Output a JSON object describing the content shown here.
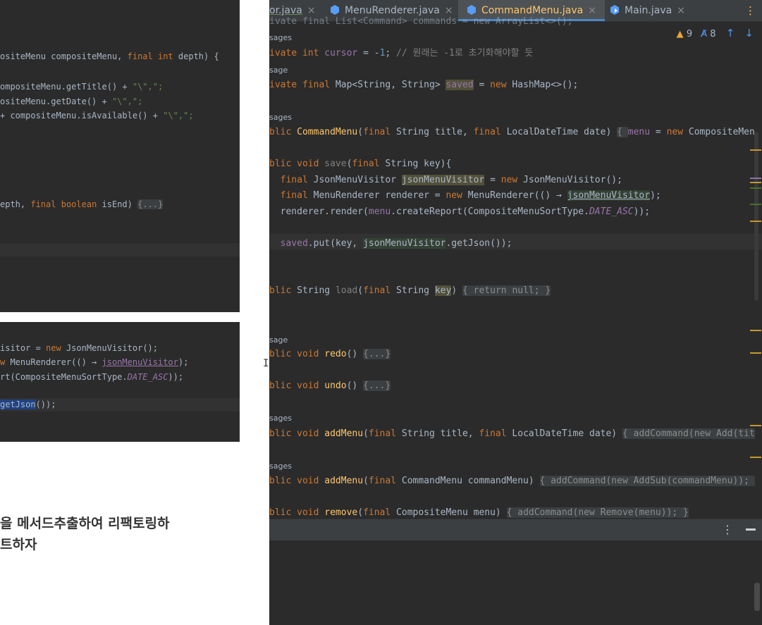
{
  "left_shots": {
    "shot1_lines": [
      {
        "parts": [
          [
            "osite",
            "t"
          ],
          [
            "Menu",
            "t"
          ],
          [
            " compositeMenu, ",
            "t"
          ],
          [
            "final",
            "kw"
          ],
          [
            " ",
            "t"
          ],
          [
            "int",
            "kw"
          ],
          [
            " depth) {",
            "t"
          ]
        ]
      },
      {
        "parts": [
          [
            "ompositeMenu.getTitle() + ",
            "t"
          ],
          [
            "\"\\\",\";",
            "str"
          ]
        ]
      },
      {
        "parts": [
          [
            "ositeMenu.getDate() + ",
            "t"
          ],
          [
            "\"\\\",\";",
            "str"
          ]
        ]
      },
      {
        "parts": [
          [
            "+ compositeMenu.isAvailable() + ",
            "t"
          ],
          [
            "\"\\\",\";",
            "str"
          ]
        ]
      },
      {
        "parts": [
          [
            "epth, ",
            "t"
          ],
          [
            "final",
            "kw"
          ],
          [
            " ",
            "t"
          ],
          [
            "boolean",
            "kw"
          ],
          [
            " isEnd) ",
            "t"
          ],
          [
            "{...}",
            "fold"
          ]
        ]
      }
    ],
    "shot2_lines": [
      {
        "parts": [
          [
            "isitor = ",
            "t"
          ],
          [
            "new",
            "kw"
          ],
          [
            " JsonMenuVisitor();",
            "t"
          ]
        ]
      },
      {
        "parts": [
          [
            "w",
            "kw"
          ],
          [
            " MenuRenderer(() → ",
            "t"
          ],
          [
            "jsonMenuVisitor",
            "field ul"
          ],
          [
            ");",
            "t"
          ]
        ]
      },
      {
        "parts": [
          [
            "rt(CompositeMenuSortType.",
            "t"
          ],
          [
            "DATE_ASC",
            "field it"
          ],
          [
            "));",
            "t"
          ]
        ]
      },
      {
        "parts": [
          [
            "getJson",
            "sel"
          ],
          [
            "());",
            "t"
          ]
        ]
      }
    ]
  },
  "caption": {
    "line1": "을 메서드추출하여 리팩토링하",
    "line2": "트하자"
  },
  "tabs": [
    {
      "label": "or.java",
      "icon": "none",
      "active": false
    },
    {
      "label": "MenuRenderer.java",
      "icon": "class-icon",
      "active": false
    },
    {
      "label": "CommandMenu.java",
      "icon": "class-icon",
      "active": true
    },
    {
      "label": "Main.java",
      "icon": "main-class-icon",
      "active": false
    }
  ],
  "tab_close_glyph": "×",
  "tab_menu_glyph": "⋮",
  "inspections": {
    "warnings": "9",
    "typos": "8",
    "warn_glyph": "▲",
    "typo_glyph": "A̸",
    "up": "↑",
    "down": "↓"
  },
  "code_lines": [
    {
      "kind": "code",
      "parts": [
        [
          "ivate final List<Command> commands = new ArrayList<>();",
          "t"
        ]
      ]
    },
    {
      "kind": "hint",
      "text": "sages"
    },
    {
      "kind": "code",
      "parts": [
        [
          "ivate",
          "kw"
        ],
        [
          " ",
          "t"
        ],
        [
          "int",
          "kw"
        ],
        [
          " ",
          "t"
        ],
        [
          "cursor",
          "field"
        ],
        [
          " = -",
          "t"
        ],
        [
          "1",
          "num"
        ],
        [
          "; ",
          "t"
        ],
        [
          "// 원래는 -1로 초기화해야할 듯",
          "cmt"
        ]
      ]
    },
    {
      "kind": "hint",
      "text": "sage"
    },
    {
      "kind": "code",
      "parts": [
        [
          "ivate",
          "kw"
        ],
        [
          " ",
          "t"
        ],
        [
          "final",
          "kw"
        ],
        [
          " Map<String, String> ",
          "t"
        ],
        [
          "saved",
          "field hl2"
        ],
        [
          " = ",
          "t"
        ],
        [
          "new",
          "kw"
        ],
        [
          " HashMap<>();",
          "t"
        ]
      ]
    },
    {
      "kind": "hint",
      "text": "sages"
    },
    {
      "kind": "code",
      "parts": [
        [
          "blic",
          "kw"
        ],
        [
          " ",
          "t"
        ],
        [
          "CommandMenu",
          "fn"
        ],
        [
          "(",
          "t"
        ],
        [
          "final",
          "kw"
        ],
        [
          " String title, ",
          "t"
        ],
        [
          "final",
          "kw"
        ],
        [
          " LocalDateTime date) ",
          "t"
        ],
        [
          "{ ",
          "fold"
        ],
        [
          "menu",
          "field"
        ],
        [
          " = ",
          "t"
        ],
        [
          "new",
          "kw"
        ],
        [
          " CompositeMen",
          "t"
        ]
      ]
    },
    {
      "kind": "code",
      "parts": [
        [
          "blic",
          "kw"
        ],
        [
          " ",
          "t"
        ],
        [
          "void",
          "kw"
        ],
        [
          " ",
          "t"
        ],
        [
          "save",
          "cmt"
        ],
        [
          "(",
          "t"
        ],
        [
          "final",
          "kw"
        ],
        [
          " String key){",
          "t"
        ]
      ]
    },
    {
      "kind": "code",
      "parts": [
        [
          "  ",
          "t"
        ],
        [
          "final",
          "kw"
        ],
        [
          " JsonMenuVisitor ",
          "t"
        ],
        [
          "jsonMenuVisitor",
          "hl2"
        ],
        [
          " = ",
          "t"
        ],
        [
          "new",
          "kw"
        ],
        [
          " JsonMenuVisitor();",
          "t"
        ]
      ]
    },
    {
      "kind": "code",
      "parts": [
        [
          "  ",
          "t"
        ],
        [
          "final",
          "kw"
        ],
        [
          " MenuRenderer renderer = ",
          "t"
        ],
        [
          "new",
          "kw"
        ],
        [
          " MenuRenderer(() → ",
          "t"
        ],
        [
          "jsonMenuVisitor",
          "ul hl"
        ],
        [
          ");",
          "t"
        ]
      ]
    },
    {
      "kind": "code",
      "parts": [
        [
          "  renderer.render(",
          "t"
        ],
        [
          "menu",
          "field"
        ],
        [
          ".createReport(CompositeMenuSortType.",
          "t"
        ],
        [
          "DATE_ASC",
          "field it"
        ],
        [
          "));",
          "t"
        ]
      ]
    },
    {
      "kind": "code",
      "parts": [
        [
          "  ",
          "t"
        ],
        [
          "saved",
          "field"
        ],
        [
          ".put(key, ",
          "t"
        ],
        [
          "jsonMenuVisitor",
          "hl"
        ],
        [
          ".getJson());",
          "t"
        ]
      ]
    },
    {
      "kind": "code",
      "parts": [
        [
          "blic",
          "kw"
        ],
        [
          " String ",
          "t"
        ],
        [
          "load",
          "cmt"
        ],
        [
          "(",
          "t"
        ],
        [
          "final",
          "kw"
        ],
        [
          " String ",
          "t"
        ],
        [
          "key",
          "hl2"
        ],
        [
          ") ",
          "t"
        ],
        [
          "{ ",
          "fold"
        ],
        [
          "return",
          "kw fold"
        ],
        [
          " ",
          "fold"
        ],
        [
          "null",
          "kw fold"
        ],
        [
          "; }",
          "fold"
        ]
      ]
    },
    {
      "kind": "hint",
      "text": "sage"
    },
    {
      "kind": "code",
      "parts": [
        [
          "blic",
          "kw"
        ],
        [
          " ",
          "t"
        ],
        [
          "void",
          "kw"
        ],
        [
          " ",
          "t"
        ],
        [
          "redo",
          "fn"
        ],
        [
          "() ",
          "t"
        ],
        [
          "{...}",
          "fold"
        ]
      ]
    },
    {
      "kind": "code",
      "parts": [
        [
          "blic",
          "kw"
        ],
        [
          " ",
          "t"
        ],
        [
          "void",
          "kw"
        ],
        [
          " ",
          "t"
        ],
        [
          "undo",
          "fn"
        ],
        [
          "() ",
          "t"
        ],
        [
          "{...}",
          "fold"
        ]
      ]
    },
    {
      "kind": "hint",
      "text": "sages"
    },
    {
      "kind": "code",
      "parts": [
        [
          "blic",
          "kw"
        ],
        [
          " ",
          "t"
        ],
        [
          "void",
          "kw"
        ],
        [
          " ",
          "t"
        ],
        [
          "addMenu",
          "fn"
        ],
        [
          "(",
          "t"
        ],
        [
          "final",
          "kw"
        ],
        [
          " String title, ",
          "t"
        ],
        [
          "final",
          "kw"
        ],
        [
          " LocalDateTime date) ",
          "t"
        ],
        [
          "{ addCommand(",
          "fold"
        ],
        [
          "new",
          "kw fold"
        ],
        [
          " Add(tit",
          "fold"
        ]
      ]
    },
    {
      "kind": "hint",
      "text": "sages"
    },
    {
      "kind": "code",
      "parts": [
        [
          "blic",
          "kw"
        ],
        [
          " ",
          "t"
        ],
        [
          "void",
          "kw"
        ],
        [
          " ",
          "t"
        ],
        [
          "addMenu",
          "fn"
        ],
        [
          "(",
          "t"
        ],
        [
          "final",
          "kw"
        ],
        [
          " CommandMenu commandMenu) ",
          "t"
        ],
        [
          "{ addCommand(",
          "fold"
        ],
        [
          "new",
          "kw fold"
        ],
        [
          " AddSub(commandMenu)); ",
          "fold"
        ]
      ]
    },
    {
      "kind": "code",
      "parts": [
        [
          "blic",
          "kw"
        ],
        [
          " ",
          "t"
        ],
        [
          "void",
          "kw"
        ],
        [
          " ",
          "t"
        ],
        [
          "remove",
          "fn"
        ],
        [
          "(",
          "t"
        ],
        [
          "final",
          "kw"
        ],
        [
          " CompositeMenu menu) ",
          "t"
        ],
        [
          "{ addCommand(",
          "fold"
        ],
        [
          "new",
          "kw fold"
        ],
        [
          " Remove(menu)); }",
          "fold"
        ]
      ]
    }
  ],
  "bottom_panel": {
    "more_glyph": "⋮",
    "minimize_label": "minimize"
  },
  "colors": {
    "keyword": "#cc7832",
    "string": "#6a8759",
    "function": "#ffc66d",
    "field": "#9876aa",
    "text": "#a9b7c6",
    "comment": "#808080",
    "background": "#2b2b2b",
    "accent": "#4a88c7"
  }
}
